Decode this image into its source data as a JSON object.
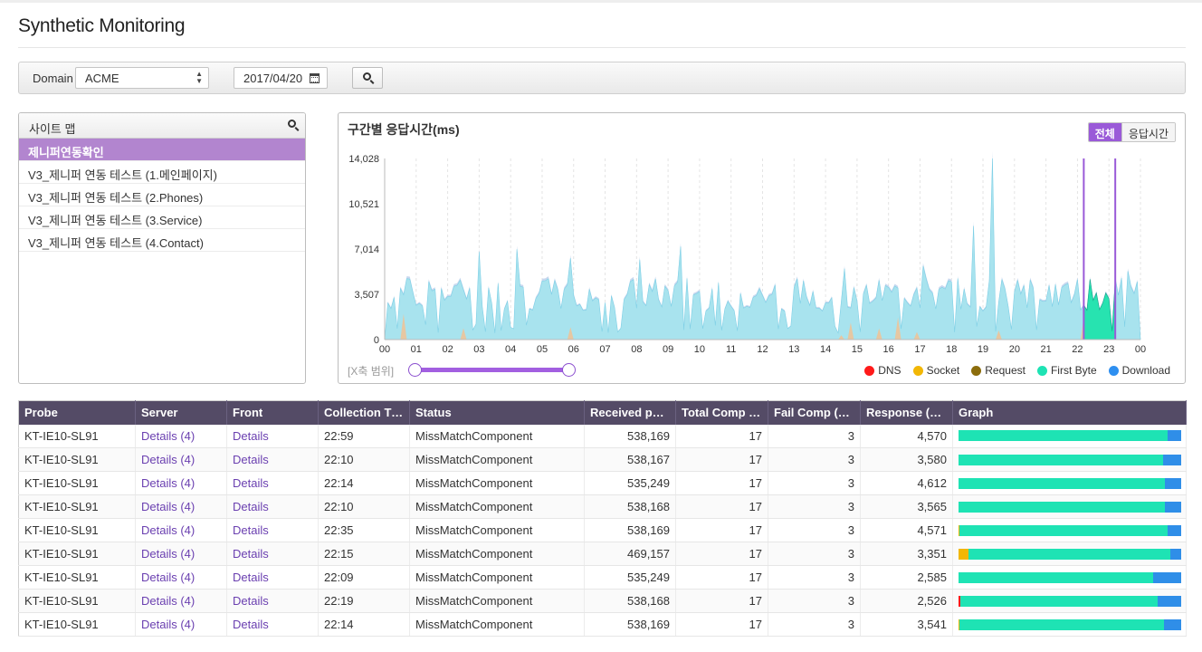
{
  "page": {
    "title": "Synthetic Monitoring"
  },
  "toolbar": {
    "domain_label": "Domain",
    "domain_value": "ACME",
    "date_value": "2017/04/20",
    "search_icon": "search-icon",
    "calendar_icon": "calendar-icon"
  },
  "sitemap": {
    "title": "사이트 맵",
    "items": [
      {
        "label": "제니퍼연동확인",
        "selected": true
      },
      {
        "label": "V3_제니퍼 연동 테스트 (1.메인페이지)",
        "selected": false
      },
      {
        "label": "V3_제니퍼 연동 테스트 (2.Phones)",
        "selected": false
      },
      {
        "label": "V3_제니퍼 연동 테스트 (3.Service)",
        "selected": false
      },
      {
        "label": "V3_제니퍼 연동 테스트 (4.Contact)",
        "selected": false
      }
    ]
  },
  "chart_panel": {
    "title": "구간별 응답시간(ms)",
    "toggle_all": "전체",
    "toggle_response": "응답시간",
    "range_label": "[X축 범위]",
    "range_value": [
      0,
      1
    ],
    "legend": [
      {
        "label": "DNS",
        "color": "#ff1a1a"
      },
      {
        "label": "Socket",
        "color": "#f2b705"
      },
      {
        "label": "Request",
        "color": "#8c6d0c"
      },
      {
        "label": "First Byte",
        "color": "#1ee3b4"
      },
      {
        "label": "Download",
        "color": "#2e8ff0"
      }
    ]
  },
  "chart_data": {
    "type": "area",
    "title": "구간별 응답시간(ms)",
    "x_ticks": [
      "00",
      "01",
      "02",
      "03",
      "04",
      "05",
      "06",
      "07",
      "08",
      "09",
      "10",
      "11",
      "12",
      "13",
      "14",
      "15",
      "16",
      "17",
      "18",
      "19",
      "20",
      "21",
      "22",
      "23",
      "00"
    ],
    "y_ticks": [
      "0",
      "3,507",
      "7,014",
      "10,521",
      "14,028"
    ],
    "ylim": [
      0,
      14028
    ],
    "xlim_hours": [
      0,
      24
    ],
    "selection_hours": [
      22.2,
      23.2
    ],
    "series": [
      {
        "color": "#a8e3ee"
      },
      {
        "color": "#e6c7a2"
      }
    ],
    "peaks": [
      {
        "hour": 3.0,
        "value": 6800
      },
      {
        "hour": 4.2,
        "value": 7000
      },
      {
        "hour": 5.9,
        "value": 6300
      },
      {
        "hour": 8.1,
        "value": 6200
      },
      {
        "hour": 9.4,
        "value": 7200
      },
      {
        "hour": 18.7,
        "value": 8800
      },
      {
        "hour": 19.3,
        "value": 14028
      },
      {
        "hour": 17.1,
        "value": 5700
      },
      {
        "hour": 14.6,
        "value": 5500
      },
      {
        "hour": 23.6,
        "value": 5300
      }
    ]
  },
  "table": {
    "columns": [
      "Probe",
      "Server",
      "Front",
      "Collection Time",
      "Status",
      "Received pack…",
      "Total Comp (c…",
      "Fail Comp (ca…",
      "Response (ms)",
      "Graph"
    ],
    "rows": [
      {
        "probe": "KT-IE10-SL91",
        "server": "Details (4)",
        "front": "Details",
        "time": "22:59",
        "status": "MissMatchComponent",
        "received": "538,169",
        "total": "17",
        "fail": "3",
        "response": "4,570",
        "graph": {
          "dns": 0.0,
          "socket": 0.0,
          "request": 0.0,
          "first_byte": 0.937,
          "download": 0.063
        }
      },
      {
        "probe": "KT-IE10-SL91",
        "server": "Details (4)",
        "front": "Details",
        "time": "22:10",
        "status": "MissMatchComponent",
        "received": "538,167",
        "total": "17",
        "fail": "3",
        "response": "3,580",
        "graph": {
          "dns": 0.0,
          "socket": 0.0,
          "request": 0.0,
          "first_byte": 0.92,
          "download": 0.08
        }
      },
      {
        "probe": "KT-IE10-SL91",
        "server": "Details (4)",
        "front": "Details",
        "time": "22:14",
        "status": "MissMatchComponent",
        "received": "535,249",
        "total": "17",
        "fail": "3",
        "response": "4,612",
        "graph": {
          "dns": 0.0,
          "socket": 0.0,
          "request": 0.0,
          "first_byte": 0.925,
          "download": 0.075
        }
      },
      {
        "probe": "KT-IE10-SL91",
        "server": "Details (4)",
        "front": "Details",
        "time": "22:10",
        "status": "MissMatchComponent",
        "received": "538,168",
        "total": "17",
        "fail": "3",
        "response": "3,565",
        "graph": {
          "dns": 0.0,
          "socket": 0.0,
          "request": 0.0,
          "first_byte": 0.925,
          "download": 0.075
        }
      },
      {
        "probe": "KT-IE10-SL91",
        "server": "Details (4)",
        "front": "Details",
        "time": "22:35",
        "status": "MissMatchComponent",
        "received": "538,169",
        "total": "17",
        "fail": "3",
        "response": "4,571",
        "graph": {
          "dns": 0.0,
          "socket": 0.004,
          "request": 0.0,
          "first_byte": 0.935,
          "download": 0.061
        }
      },
      {
        "probe": "KT-IE10-SL91",
        "server": "Details (4)",
        "front": "Details",
        "time": "22:15",
        "status": "MissMatchComponent",
        "received": "469,157",
        "total": "17",
        "fail": "3",
        "response": "3,351",
        "graph": {
          "dns": 0.0,
          "socket": 0.045,
          "request": 0.0,
          "first_byte": 0.905,
          "download": 0.05
        }
      },
      {
        "probe": "KT-IE10-SL91",
        "server": "Details (4)",
        "front": "Details",
        "time": "22:09",
        "status": "MissMatchComponent",
        "received": "535,249",
        "total": "17",
        "fail": "3",
        "response": "2,585",
        "graph": {
          "dns": 0.0,
          "socket": 0.0,
          "request": 0.0,
          "first_byte": 0.875,
          "download": 0.125
        }
      },
      {
        "probe": "KT-IE10-SL91",
        "server": "Details (4)",
        "front": "Details",
        "time": "22:19",
        "status": "MissMatchComponent",
        "received": "538,168",
        "total": "17",
        "fail": "3",
        "response": "2,526",
        "graph": {
          "dns": 0.01,
          "socket": 0.0,
          "request": 0.0,
          "first_byte": 0.885,
          "download": 0.105
        }
      },
      {
        "probe": "KT-IE10-SL91",
        "server": "Details (4)",
        "front": "Details",
        "time": "22:14",
        "status": "MissMatchComponent",
        "received": "538,169",
        "total": "17",
        "fail": "3",
        "response": "3,541",
        "graph": {
          "dns": 0.0,
          "socket": 0.004,
          "request": 0.0,
          "first_byte": 0.918,
          "download": 0.078
        }
      }
    ]
  },
  "graph_colors": {
    "dns": "#ff1a1a",
    "socket": "#f2b705",
    "request": "#8c6d0c",
    "first_byte": "#1ee3b4",
    "download": "#2e8ff0"
  }
}
